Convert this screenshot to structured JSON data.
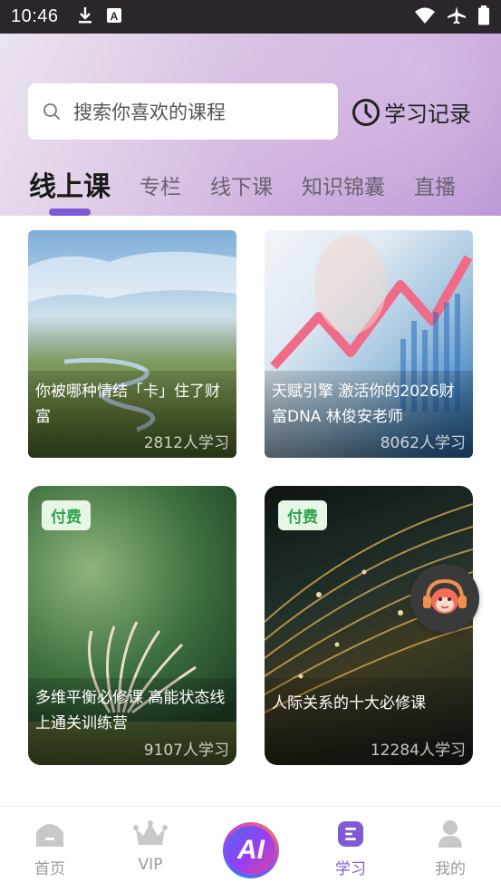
{
  "status_bar": {
    "time": "10:46",
    "icons": [
      "download-icon",
      "app-a-icon",
      "wifi-icon",
      "airplane-icon",
      "battery-icon"
    ]
  },
  "header": {
    "search_placeholder": "搜索你喜欢的课程",
    "history_label": "学习记录",
    "tabs": [
      {
        "label": "线上课",
        "active": true
      },
      {
        "label": "专栏",
        "active": false
      },
      {
        "label": "线下课",
        "active": false
      },
      {
        "label": "知识锦囊",
        "active": false
      },
      {
        "label": "直播",
        "active": false
      }
    ]
  },
  "courses": [
    {
      "title": "你被哪种情结「卡」住了财富",
      "learners": "2812人学习",
      "paid": false
    },
    {
      "title": "天赋引擎 激活你的2026财富DNA 林俊安老师",
      "learners": "8062人学习",
      "paid": false
    },
    {
      "title": "多维平衡必修课 高能状态线上通关训练营",
      "learners": "9107人学习",
      "paid": true,
      "badge": "付费"
    },
    {
      "title": "人际关系的十大必修课",
      "learners": "12284人学习",
      "paid": true,
      "badge": "付费"
    }
  ],
  "bottom_nav": [
    {
      "label": "首页",
      "icon": "home-icon",
      "active": false
    },
    {
      "label": "VIP",
      "icon": "crown-icon",
      "active": false
    },
    {
      "label": "AI",
      "icon": "ai-icon",
      "active": false
    },
    {
      "label": "学习",
      "icon": "study-icon",
      "active": true
    },
    {
      "label": "我的",
      "icon": "profile-icon",
      "active": false
    }
  ],
  "colors": {
    "accent": "#7f5ad4",
    "badge_bg": "#e7f7e5",
    "badge_text": "#2ea34d"
  }
}
